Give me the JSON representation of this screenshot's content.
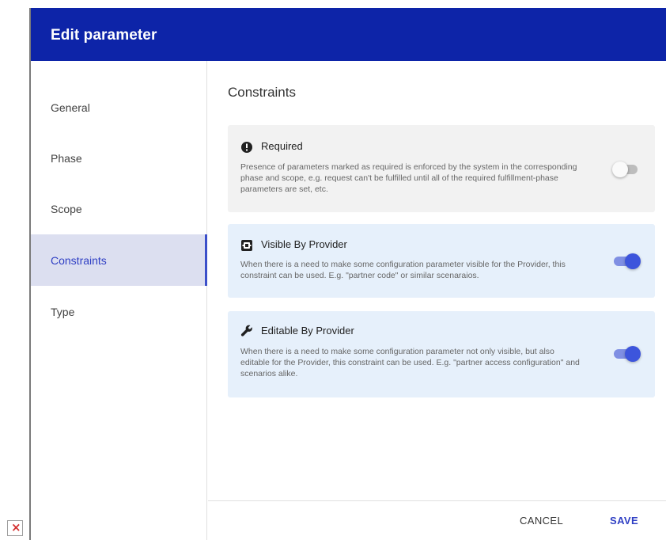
{
  "dialog": {
    "title": "Edit parameter"
  },
  "sidebar": {
    "items": [
      {
        "label": "General",
        "active": false
      },
      {
        "label": "Phase",
        "active": false
      },
      {
        "label": "Scope",
        "active": false
      },
      {
        "label": "Constraints",
        "active": true
      },
      {
        "label": "Type",
        "active": false
      }
    ]
  },
  "main": {
    "section_title": "Constraints",
    "constraints": [
      {
        "icon": "exclamation-circle-icon",
        "title": "Required",
        "description": "Presence of parameters marked as required is enforced by the system in the corresponding phase and scope, e.g. request can't be fulfilled until all of the required fulfillment-phase parameters are set, etc.",
        "enabled": false
      },
      {
        "icon": "provider-badge-icon",
        "title": "Visible By Provider",
        "description": "When there is a need to make some configuration parameter visible for the Provider, this constraint can be used. E.g. \"partner code\" or similar scenaraios.",
        "enabled": true
      },
      {
        "icon": "wrench-icon",
        "title": "Editable By Provider",
        "description": "When there is a need to make some configuration parameter not only visible, but also editable for the Provider, this constraint can be used. E.g. \"partner access configuration\" and scenarios alike.",
        "enabled": true
      }
    ]
  },
  "footer": {
    "cancel_label": "CANCEL",
    "save_label": "SAVE"
  },
  "colors": {
    "header_bg": "#0d24a8",
    "accent": "#3d55dc",
    "active_nav_bg": "#dcdff0",
    "required_card_bg": "#f2f2f2",
    "provider_card_bg": "#e6f0fb"
  },
  "broken_image_icon": "broken-image-icon"
}
